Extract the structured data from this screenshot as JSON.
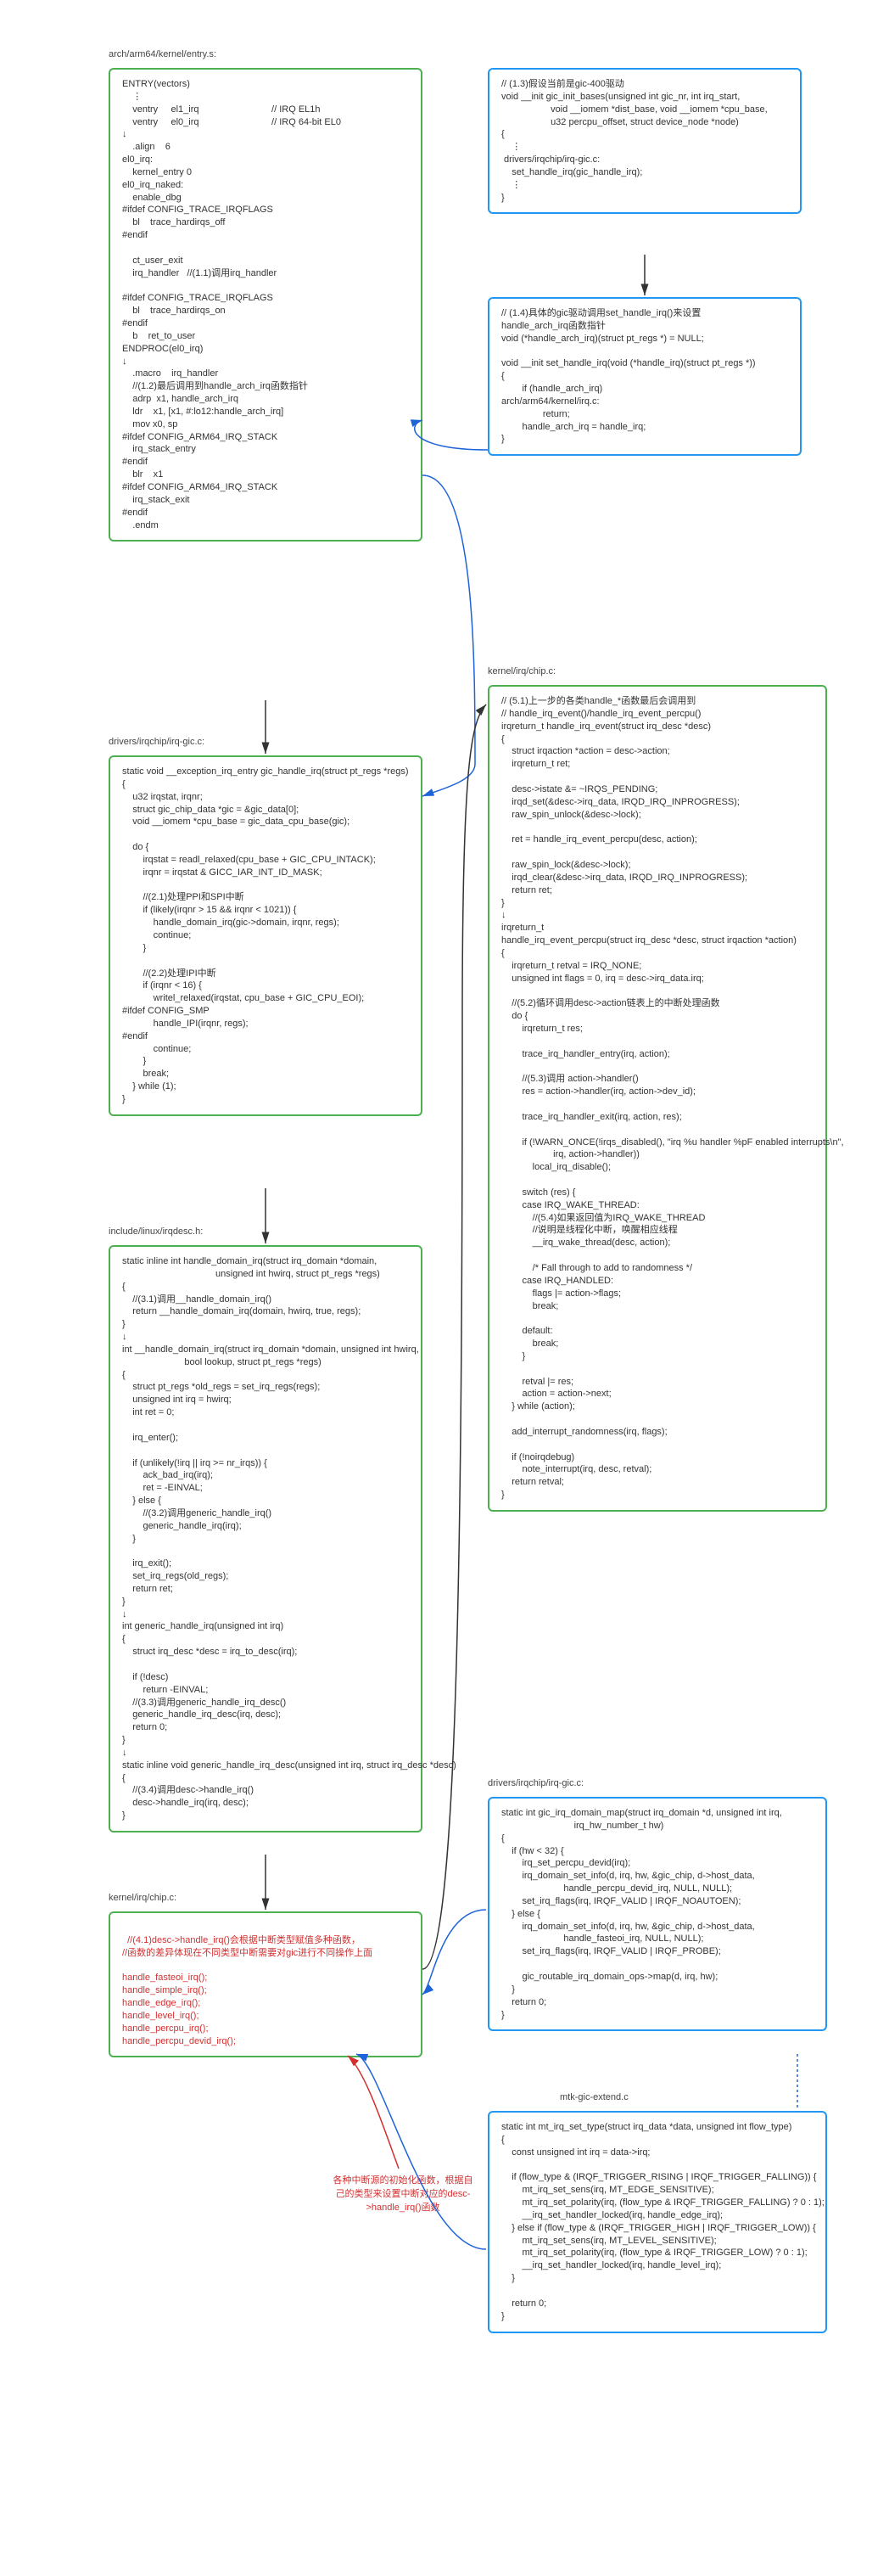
{
  "labels": {
    "file1": "arch/arm64/kernel/entry.s:",
    "file2": "drivers/irqchip/irq-gic.c:",
    "file3": "include/linux/irqdesc.h:",
    "file4": "kernel/irq/chip.c:",
    "file5": "kernel/irq/chip.c:",
    "file6": "drivers/irqchip/irq-gic.c:",
    "file7": "mtk-gic-extend.c",
    "annot_red": "各种中断源的初始化函数，根据自己的类型来设置中断对应的desc->handle_irq()函数"
  },
  "box_entry": "ENTRY(vectors)\n    ⋮\n    ventry     el1_irq                            // IRQ EL1h\n    ventry     el0_irq                            // IRQ 64-bit EL0\n↓\n    .align    6\nel0_irq:\n    kernel_entry 0\nel0_irq_naked:\n    enable_dbg\n#ifdef CONFIG_TRACE_IRQFLAGS\n    bl    trace_hardirqs_off\n#endif\n\n    ct_user_exit\n    irq_handler   //(1.1)调用irq_handler\n\n#ifdef CONFIG_TRACE_IRQFLAGS\n    bl    trace_hardirqs_on\n#endif\n    b    ret_to_user\nENDPROC(el0_irq)\n↓\n    .macro    irq_handler\n    //(1.2)最后调用到handle_arch_irq函数指针\n    adrp  x1, handle_arch_irq\n    ldr    x1, [x1, #:lo12:handle_arch_irq]\n    mov x0, sp\n#ifdef CONFIG_ARM64_IRQ_STACK\n    irq_stack_entry\n#endif\n    blr    x1\n#ifdef CONFIG_ARM64_IRQ_STACK\n    irq_stack_exit\n#endif\n    .endm",
  "box_gic_init": "// (1.3)假设当前是gic-400驱动\nvoid __init gic_init_bases(unsigned int gic_nr, int irq_start,\n                   void __iomem *dist_base, void __iomem *cpu_base,\n                   u32 percpu_offset, struct device_node *node)\n{\n    ⋮\n drivers/irqchip/irq-gic.c:\n    set_handle_irq(gic_handle_irq);\n    ⋮\n}",
  "box_set_handle": "// (1.4)具体的gic驱动调用set_handle_irq()来设置\nhandle_arch_irq函数指针\nvoid (*handle_arch_irq)(struct pt_regs *) = NULL;\n\nvoid __init set_handle_irq(void (*handle_irq)(struct pt_regs *))\n{\n        if (handle_arch_irq)\narch/arm64/kernel/irq.c:\n                return;\n        handle_arch_irq = handle_irq;\n}",
  "box_gic_handle": "static void __exception_irq_entry gic_handle_irq(struct pt_regs *regs)\n{\n    u32 irqstat, irqnr;\n    struct gic_chip_data *gic = &gic_data[0];\n    void __iomem *cpu_base = gic_data_cpu_base(gic);\n\n    do {\n        irqstat = readl_relaxed(cpu_base + GIC_CPU_INTACK);\n        irqnr = irqstat & GICC_IAR_INT_ID_MASK;\n\n        //(2.1)处理PPI和SPI中断\n        if (likely(irqnr > 15 && irqnr < 1021)) {\n            handle_domain_irq(gic->domain, irqnr, regs);\n            continue;\n        }\n\n        //(2.2)处理IPI中断\n        if (irqnr < 16) {\n            writel_relaxed(irqstat, cpu_base + GIC_CPU_EOI);\n#ifdef CONFIG_SMP\n            handle_IPI(irqnr, regs);\n#endif\n            continue;\n        }\n        break;\n    } while (1);\n}",
  "box_irqdesc": "static inline int handle_domain_irq(struct irq_domain *domain,\n                                    unsigned int hwirq, struct pt_regs *regs)\n{\n    //(3.1)调用__handle_domain_irq()\n    return __handle_domain_irq(domain, hwirq, true, regs);\n}\n↓\nint __handle_domain_irq(struct irq_domain *domain, unsigned int hwirq,\n                        bool lookup, struct pt_regs *regs)\n{\n    struct pt_regs *old_regs = set_irq_regs(regs);\n    unsigned int irq = hwirq;\n    int ret = 0;\n\n    irq_enter();\n\n    if (unlikely(!irq || irq >= nr_irqs)) {\n        ack_bad_irq(irq);\n        ret = -EINVAL;\n    } else {\n        //(3.2)调用generic_handle_irq()\n        generic_handle_irq(irq);\n    }\n\n    irq_exit();\n    set_irq_regs(old_regs);\n    return ret;\n}\n↓\nint generic_handle_irq(unsigned int irq)\n{\n    struct irq_desc *desc = irq_to_desc(irq);\n\n    if (!desc)\n        return -EINVAL;\n    //(3.3)调用generic_handle_irq_desc()\n    generic_handle_irq_desc(irq, desc);\n    return 0;\n}\n↓\nstatic inline void generic_handle_irq_desc(unsigned int irq, struct irq_desc *desc)\n{\n    //(3.4)调用desc->handle_irq()\n    desc->handle_irq(irq, desc);\n}",
  "box_chip1_a": "//(4.1)desc->handle_irq()会根据中断类型赋值多种函数，\n//函数的差异体现在不同类型中断需要对gic进行不同操作上面",
  "box_chip1_b": "handle_fasteoi_irq();\nhandle_simple_irq();\nhandle_edge_irq();\nhandle_level_irq();\nhandle_percpu_irq();\nhandle_percpu_devid_irq();",
  "box_chip2": "// (5.1)上一步的各类handle_*函数最后会调用到\n// handle_irq_event()/handle_irq_event_percpu()\nirqreturn_t handle_irq_event(struct irq_desc *desc)\n{\n    struct irqaction *action = desc->action;\n    irqreturn_t ret;\n\n    desc->istate &= ~IRQS_PENDING;\n    irqd_set(&desc->irq_data, IRQD_IRQ_INPROGRESS);\n    raw_spin_unlock(&desc->lock);\n\n    ret = handle_irq_event_percpu(desc, action);\n\n    raw_spin_lock(&desc->lock);\n    irqd_clear(&desc->irq_data, IRQD_IRQ_INPROGRESS);\n    return ret;\n}\n↓\nirqreturn_t\nhandle_irq_event_percpu(struct irq_desc *desc, struct irqaction *action)\n{\n    irqreturn_t retval = IRQ_NONE;\n    unsigned int flags = 0, irq = desc->irq_data.irq;\n\n    //(5.2)循环调用desc->action链表上的中断处理函数\n    do {\n        irqreturn_t res;\n\n        trace_irq_handler_entry(irq, action);\n\n        //(5.3)调用 action->handler()\n        res = action->handler(irq, action->dev_id);\n\n        trace_irq_handler_exit(irq, action, res);\n\n        if (!WARN_ONCE(!irqs_disabled(), \"irq %u handler %pF enabled interrupts\\n\",\n                    irq, action->handler))\n            local_irq_disable();\n\n        switch (res) {\n        case IRQ_WAKE_THREAD:\n            //(5.4)如果返回值为IRQ_WAKE_THREAD\n            //说明是线程化中断，唤醒相应线程\n            __irq_wake_thread(desc, action);\n\n            /* Fall through to add to randomness */\n        case IRQ_HANDLED:\n            flags |= action->flags;\n            break;\n\n        default:\n            break;\n        }\n\n        retval |= res;\n        action = action->next;\n    } while (action);\n\n    add_interrupt_randomness(irq, flags);\n\n    if (!noirqdebug)\n        note_interrupt(irq, desc, retval);\n    return retval;\n}",
  "box_gicmap": "static int gic_irq_domain_map(struct irq_domain *d, unsigned int irq,\n                            irq_hw_number_t hw)\n{\n    if (hw < 32) {\n        irq_set_percpu_devid(irq);\n        irq_domain_set_info(d, irq, hw, &gic_chip, d->host_data,\n                        handle_percpu_devid_irq, NULL, NULL);\n        set_irq_flags(irq, IRQF_VALID | IRQF_NOAUTOEN);\n    } else {\n        irq_domain_set_info(d, irq, hw, &gic_chip, d->host_data,\n                        handle_fasteoi_irq, NULL, NULL);\n        set_irq_flags(irq, IRQF_VALID | IRQF_PROBE);\n\n        gic_routable_irq_domain_ops->map(d, irq, hw);\n    }\n    return 0;\n}",
  "box_mtk": "static int mt_irq_set_type(struct irq_data *data, unsigned int flow_type)\n{\n    const unsigned int irq = data->irq;\n\n    if (flow_type & (IRQF_TRIGGER_RISING | IRQF_TRIGGER_FALLING)) {\n        mt_irq_set_sens(irq, MT_EDGE_SENSITIVE);\n        mt_irq_set_polarity(irq, (flow_type & IRQF_TRIGGER_FALLING) ? 0 : 1);\n        __irq_set_handler_locked(irq, handle_edge_irq);\n    } else if (flow_type & (IRQF_TRIGGER_HIGH | IRQF_TRIGGER_LOW)) {\n        mt_irq_set_sens(irq, MT_LEVEL_SENSITIVE);\n        mt_irq_set_polarity(irq, (flow_type & IRQF_TRIGGER_LOW) ? 0 : 1);\n        __irq_set_handler_locked(irq, handle_level_irq);\n    }\n\n    return 0;\n}"
}
